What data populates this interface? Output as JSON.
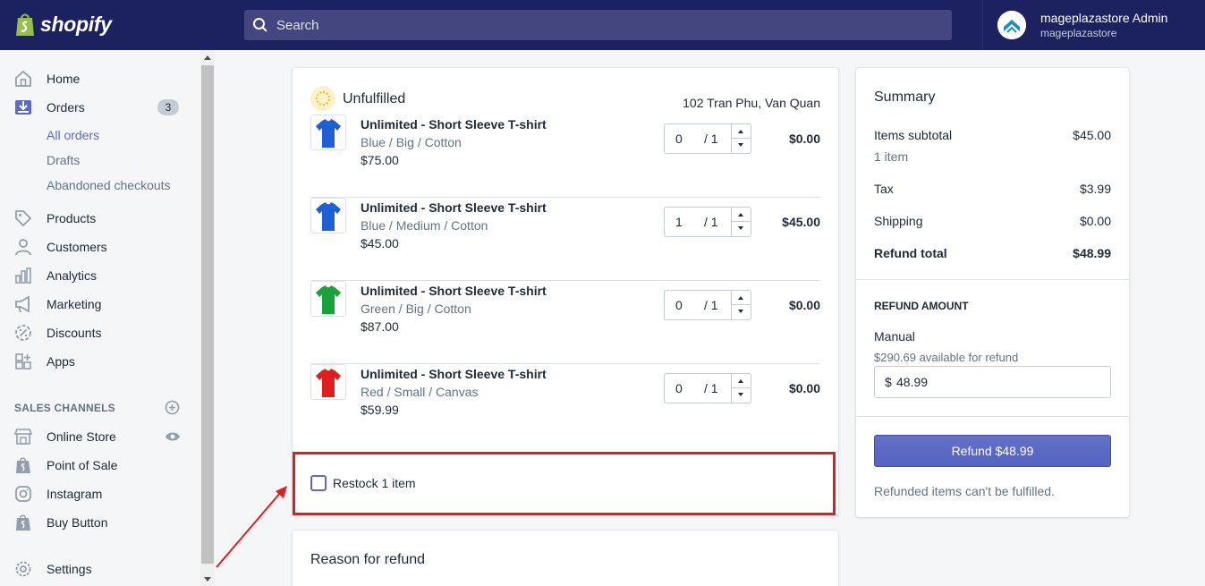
{
  "app": {
    "brand": "shopify",
    "accent": "#5c6ac4",
    "topbar_color": "#1c2260",
    "highlight_color": "#e01e1e"
  },
  "search": {
    "placeholder": "Search"
  },
  "account": {
    "name": "mageplazastore Admin",
    "store": "mageplazastore"
  },
  "sidebar": {
    "items": [
      {
        "label": "Home",
        "icon": "home-icon"
      },
      {
        "label": "Orders",
        "icon": "orders-icon",
        "badge": "3"
      },
      {
        "label": "Products",
        "icon": "tag-icon"
      },
      {
        "label": "Customers",
        "icon": "person-icon"
      },
      {
        "label": "Analytics",
        "icon": "bar-chart-icon"
      },
      {
        "label": "Marketing",
        "icon": "megaphone-icon"
      },
      {
        "label": "Discounts",
        "icon": "discount-icon"
      },
      {
        "label": "Apps",
        "icon": "apps-icon"
      }
    ],
    "order_subitems": [
      "All orders",
      "Drafts",
      "Abandoned checkouts"
    ],
    "sales_channels_title": "SALES CHANNELS",
    "channels": [
      {
        "label": "Online Store",
        "icon": "store-icon"
      },
      {
        "label": "Point of Sale",
        "icon": "shopify-bag-icon"
      },
      {
        "label": "Instagram",
        "icon": "instagram-icon"
      },
      {
        "label": "Buy Button",
        "icon": "shopify-bag-icon"
      }
    ],
    "settings": "Settings"
  },
  "fulfillment": {
    "title": "Unfulfilled",
    "address": "102 Tran Phu, Van Quan",
    "items": [
      {
        "name": "Unlimited - Short Sleeve T-shirt",
        "variant": "Blue / Big / Cotton",
        "price": "$75.00",
        "qty": "0",
        "max": "/ 1",
        "total": "$0.00",
        "color": "#1f5fd6"
      },
      {
        "name": "Unlimited - Short Sleeve T-shirt",
        "variant": "Blue / Medium / Cotton",
        "price": "$45.00",
        "qty": "1",
        "max": "/ 1",
        "total": "$45.00",
        "color": "#1f5fd6"
      },
      {
        "name": "Unlimited - Short Sleeve T-shirt",
        "variant": "Green / Big / Cotton",
        "price": "$87.00",
        "qty": "0",
        "max": "/ 1",
        "total": "$0.00",
        "color": "#17a33a"
      },
      {
        "name": "Unlimited - Short Sleeve T-shirt",
        "variant": "Red / Small / Canvas",
        "price": "$59.99",
        "qty": "0",
        "max": "/ 1",
        "total": "$0.00",
        "color": "#e01e1e"
      }
    ],
    "restock_label": "Restock 1 item"
  },
  "reason": {
    "title": "Reason for refund"
  },
  "summary": {
    "title": "Summary",
    "subtotal_label": "Items subtotal",
    "subtotal_value": "$45.00",
    "items_count": "1 item",
    "tax_label": "Tax",
    "tax_value": "$3.99",
    "shipping_label": "Shipping",
    "shipping_value": "$0.00",
    "total_label": "Refund total",
    "total_value": "$48.99",
    "refund_amount_title": "REFUND AMOUNT",
    "manual_label": "Manual",
    "available": "$290.69 available for refund",
    "currency": "$",
    "amount": "48.99",
    "refund_button": "Refund $48.99",
    "note": "Refunded items can't be fulfilled."
  }
}
